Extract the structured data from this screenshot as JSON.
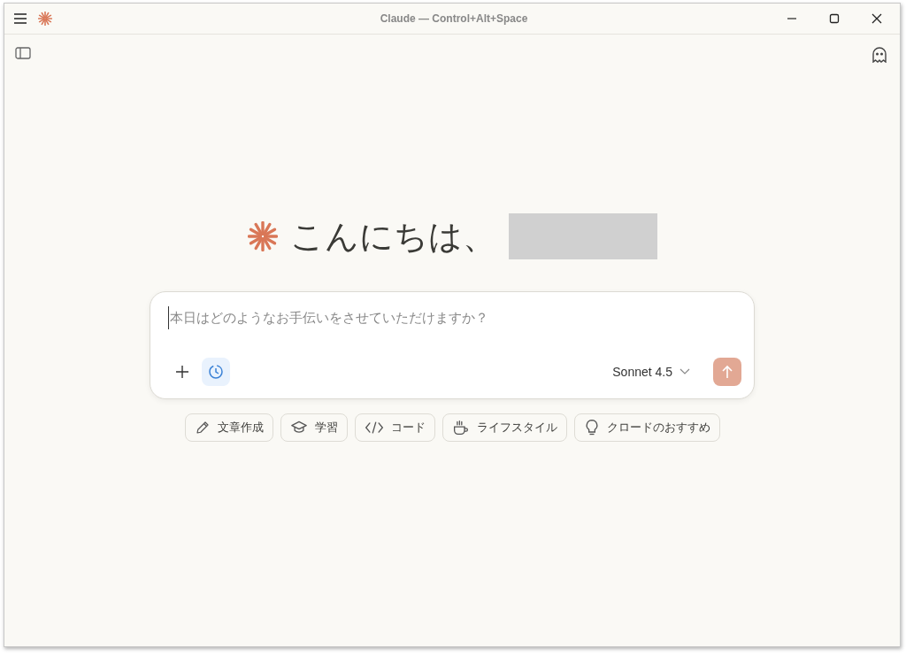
{
  "window": {
    "title": "Claude — Control+Alt+Space"
  },
  "greeting": {
    "text": "こんにちは、",
    "name_redacted": true
  },
  "composer": {
    "placeholder": "本日はどのようなお手伝いをさせていただけますか？",
    "research_on": true,
    "model": "Sonnet 4.5",
    "send_disabled": true
  },
  "suggestions": [
    {
      "label": "文章作成"
    },
    {
      "label": "学習"
    },
    {
      "label": "コード"
    },
    {
      "label": "ライフスタイル"
    },
    {
      "label": "クロードのおすすめ"
    }
  ]
}
